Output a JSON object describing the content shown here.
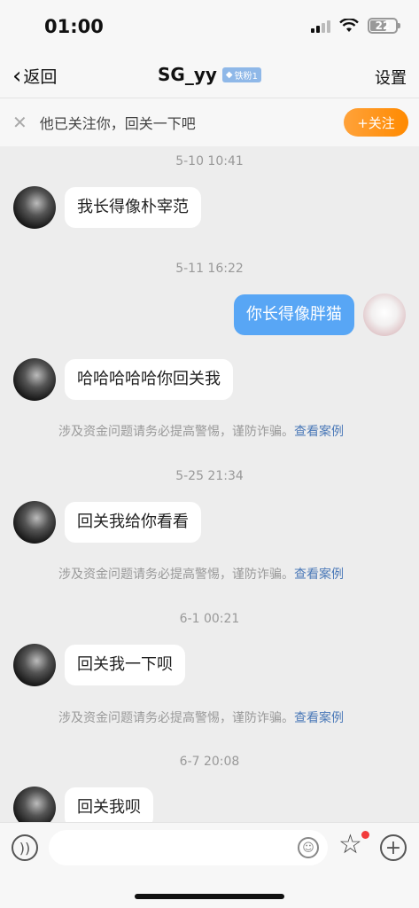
{
  "status": {
    "time": "01:00",
    "battery": "22"
  },
  "nav": {
    "back_label": "返回",
    "title": "SG_yy",
    "fan_badge": "铁粉1",
    "settings_label": "设置"
  },
  "follow_bar": {
    "message": "他已关注你，回关一下吧",
    "button_label": "+关注"
  },
  "messages": [
    {
      "time": "5-10 10:41",
      "text": "我长得像朴宰范",
      "from": "other"
    },
    {
      "time": "5-11 16:22",
      "text": "你长得像胖猫",
      "from": "me"
    },
    {
      "text": "哈哈哈哈哈你回关我",
      "from": "other"
    },
    {
      "warning": true
    },
    {
      "time": "5-25 21:34",
      "text": "回关我给你看看",
      "from": "other"
    },
    {
      "warning": true
    },
    {
      "time": "6-1 00:21",
      "text": "回关我一下呗",
      "from": "other"
    },
    {
      "warning": true
    },
    {
      "time": "6-7 20:08",
      "text": "回关我呗",
      "from": "other"
    }
  ],
  "warning": {
    "text": "涉及资金问题请务必提高警惕，谨防诈骗。",
    "link": "查看案例"
  },
  "input": {
    "placeholder": ""
  },
  "colors": {
    "accent_blue": "#58a6f5",
    "follow_orange": "#ff9a1f",
    "link": "#4b79b8",
    "notify_red": "#f23b3b"
  }
}
